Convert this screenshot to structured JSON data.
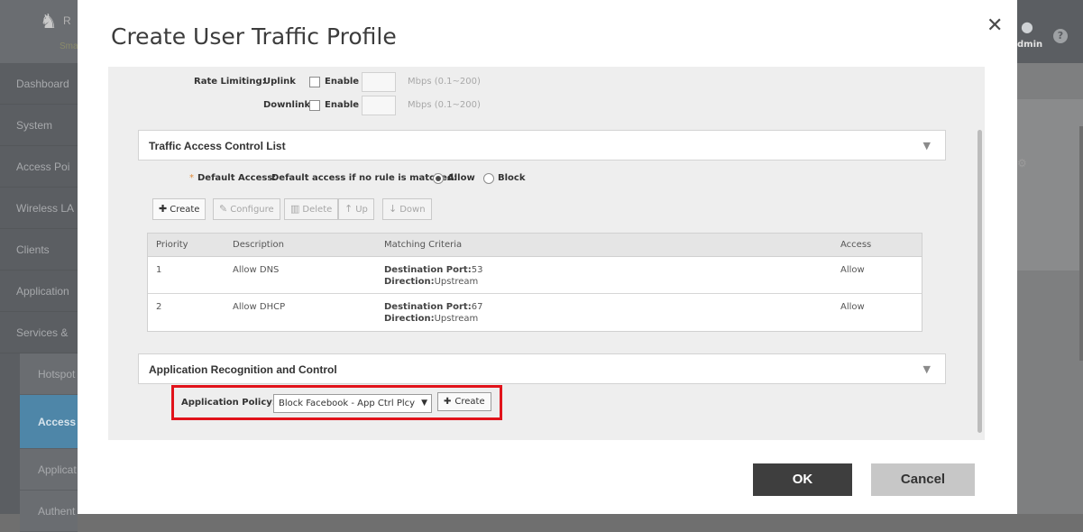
{
  "app": {
    "logo_r": "R",
    "logo_sub": "Sma",
    "nav": [
      "Dashboard",
      "System",
      "Access Poi",
      "Wireless LA",
      "Clients",
      "Application",
      "Services &"
    ],
    "subnav": [
      "Hotspot",
      "Access (",
      "Applicat",
      "Authent"
    ],
    "user_label": "dmin"
  },
  "modal": {
    "title": "Create User Traffic Profile",
    "close": "✕",
    "rate_limiting": {
      "label": "Rate Limiting:",
      "uplink_label": "Uplink",
      "downlink_label": "Downlink",
      "enable_label": "Enable",
      "hint": "Mbps (0.1~200)"
    },
    "tacl": {
      "title": "Traffic Access Control List",
      "toggle": "▼",
      "required_mark": "*",
      "default_access_label": "Default Access:",
      "default_access_text": "Default access if no rule is matched:",
      "allow_label": "Allow",
      "block_label": "Block",
      "toolbar": {
        "create": "Create",
        "configure": "Configure",
        "delete": "Delete",
        "up": "Up",
        "down": "Down"
      },
      "columns": [
        "Priority",
        "Description",
        "Matching Criteria",
        "Access"
      ],
      "rows": [
        {
          "priority": "1",
          "description": "Allow DNS",
          "crit1_k": "Destination Port:",
          "crit1_v": "53",
          "crit2_k": "Direction:",
          "crit2_v": "Upstream",
          "access": "Allow"
        },
        {
          "priority": "2",
          "description": "Allow DHCP",
          "crit1_k": "Destination Port:",
          "crit1_v": "67",
          "crit2_k": "Direction:",
          "crit2_v": "Upstream",
          "access": "Allow"
        }
      ]
    },
    "arc": {
      "title": "Application Recognition and Control",
      "toggle": "▼",
      "policy_label": "Application Policy:",
      "policy_value": "Block Facebook - App Ctrl Plcy",
      "create_label": "Create"
    },
    "ok_label": "OK",
    "cancel_label": "Cancel"
  }
}
